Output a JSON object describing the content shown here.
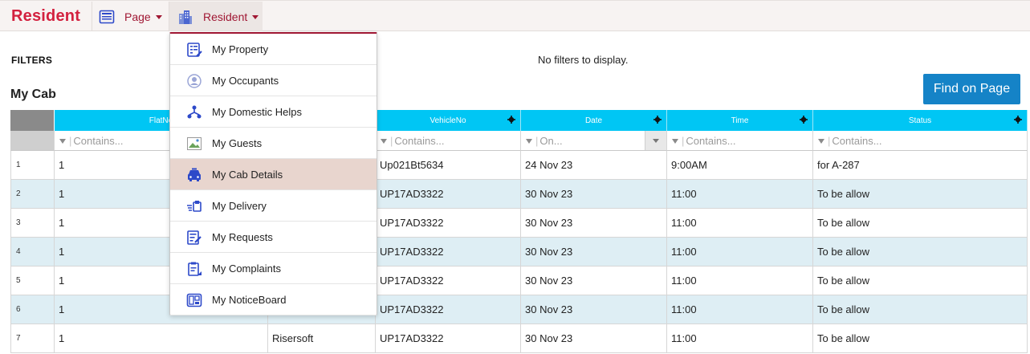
{
  "nav": {
    "brand": "Resident",
    "page_menu": "Page",
    "resident_menu": "Resident"
  },
  "filters": {
    "label": "FILTERS",
    "empty_text": "No filters to display."
  },
  "section": {
    "title": "My Cab",
    "find_button": "Find on Page"
  },
  "grid": {
    "columns": [
      "FlatNo",
      "",
      "VehicleNo",
      "Date",
      "Time",
      "Status"
    ],
    "filter_placeholders": [
      "Contains...",
      "",
      "Contains...",
      "On...",
      "Contains...",
      "Contains..."
    ],
    "rows": [
      {
        "num": "1",
        "flat": "1",
        "name": "",
        "vehicle": "Up021Bt5634",
        "date": "24 Nov 23",
        "time": "9:00AM",
        "status": "for A-287"
      },
      {
        "num": "2",
        "flat": "1",
        "name": "",
        "vehicle": "UP17AD3322",
        "date": "30 Nov 23",
        "time": "11:00",
        "status": "To be allow"
      },
      {
        "num": "3",
        "flat": "1",
        "name": "",
        "vehicle": "UP17AD3322",
        "date": "30 Nov 23",
        "time": "11:00",
        "status": "To be allow"
      },
      {
        "num": "4",
        "flat": "1",
        "name": "",
        "vehicle": "UP17AD3322",
        "date": "30 Nov 23",
        "time": "11:00",
        "status": "To be allow"
      },
      {
        "num": "5",
        "flat": "1",
        "name": "",
        "vehicle": "UP17AD3322",
        "date": "30 Nov 23",
        "time": "11:00",
        "status": "To be allow"
      },
      {
        "num": "6",
        "flat": "1",
        "name": "",
        "vehicle": "UP17AD3322",
        "date": "30 Nov 23",
        "time": "11:00",
        "status": "To be allow"
      },
      {
        "num": "7",
        "flat": "1",
        "name": "Risersoft",
        "vehicle": "UP17AD3322",
        "date": "30 Nov 23",
        "time": "11:00",
        "status": "To be allow"
      }
    ]
  },
  "menu": {
    "items": [
      {
        "label": "My Property",
        "icon": "property-icon"
      },
      {
        "label": "My Occupants",
        "icon": "occupants-icon"
      },
      {
        "label": "My Domestic Helps",
        "icon": "domestic-helps-icon"
      },
      {
        "label": "My Guests",
        "icon": "guests-icon"
      },
      {
        "label": "My Cab Details",
        "icon": "cab-icon",
        "active": true
      },
      {
        "label": "My Delivery",
        "icon": "delivery-icon"
      },
      {
        "label": "My Requests",
        "icon": "requests-icon"
      },
      {
        "label": "My Complaints",
        "icon": "complaints-icon"
      },
      {
        "label": "My NoticeBoard",
        "icon": "noticeboard-icon"
      }
    ]
  },
  "colors": {
    "brand": "#d3213f",
    "header": "#00c6f4",
    "button": "#1583c7",
    "alt_row": "#deeef4",
    "active_menu": "#e8d5ce"
  }
}
